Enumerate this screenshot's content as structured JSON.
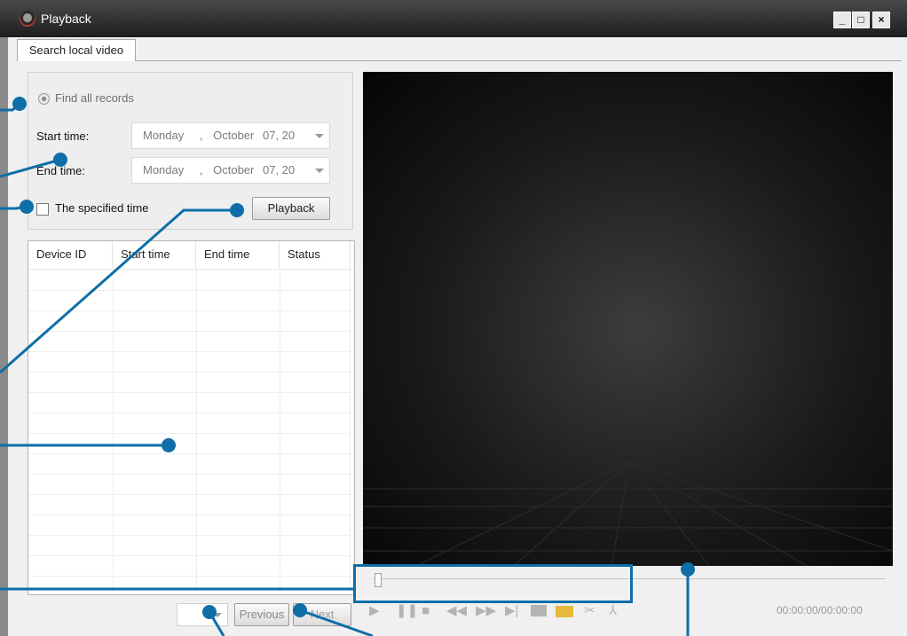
{
  "window": {
    "title": "Playback",
    "controls": [
      "_",
      "□",
      "×"
    ]
  },
  "tabs": [
    {
      "label": "Search local video",
      "selected": true
    }
  ],
  "search": {
    "find_all_label": "Find all records",
    "start_label": "Start time:",
    "end_label": "End time:",
    "start_value": {
      "day": "Monday",
      "sep": ",",
      "month": "October",
      "date": "07, 20"
    },
    "end_value": {
      "day": "Monday",
      "sep": ",",
      "month": "October",
      "date": "07, 20"
    },
    "specified_label": "The specified time",
    "specified_checked": false,
    "playback_button": "Playback"
  },
  "results": {
    "columns": [
      "Device ID",
      "Start time",
      "End time",
      "Status"
    ],
    "rows": []
  },
  "pager": {
    "page_value": "",
    "previous": "Previous",
    "next": "Next"
  },
  "player": {
    "progress": 0,
    "timecode": "00:00:00/00:00:00",
    "controls": [
      "play-icon",
      "pause-icon",
      "stop-icon",
      "rewind-icon",
      "fast-forward-icon",
      "step-frame-icon",
      "snapshot-icon",
      "open-folder-icon",
      "cut-icon",
      "merge-icon"
    ]
  },
  "colors": {
    "titlebar": "#2e2e2e",
    "annotation": "#0f6ea8",
    "video_bg": "#0a0a0a"
  }
}
